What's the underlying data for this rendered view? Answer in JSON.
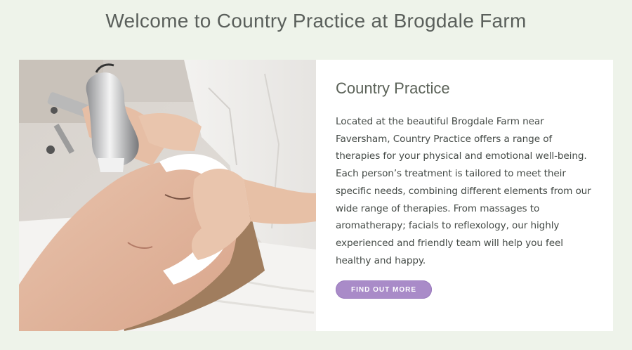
{
  "page": {
    "title": "Welcome to Country Practice at Brogdale Farm"
  },
  "card": {
    "image": {
      "subject": "therapist giving facial treatment to woman lying on towel"
    },
    "heading": "Country Practice",
    "description": "Located at the beautiful Brogdale Farm near Faversham, Country Practice offers a range of therapies for your physical and emotional well-being. Each person’s treatment is tailored to meet their specific needs, combining different elements from our wide range of therapies. From massages to aromatherapy; facials to reflexology, our highly experienced and friendly team will help you feel healthy and happy.",
    "button_label": "FIND OUT MORE"
  },
  "colors": {
    "background": "#eef3ea",
    "card": "#ffffff",
    "accent": "#a98bc8",
    "heading": "#5b6258"
  }
}
